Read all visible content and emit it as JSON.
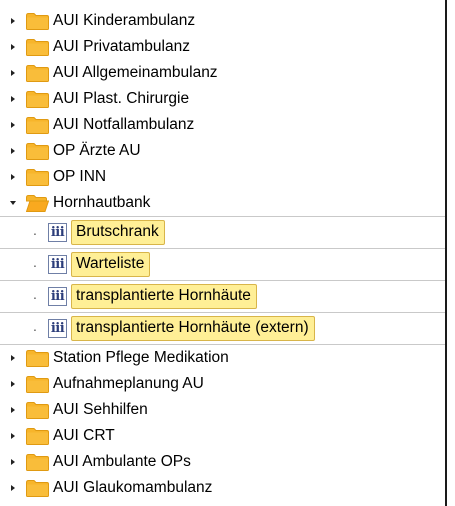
{
  "tree": {
    "top_items": [
      {
        "label": "AUI Kinderambulanz"
      },
      {
        "label": "AUI Privatambulanz"
      },
      {
        "label": "AUI Allgemeinambulanz"
      },
      {
        "label": "AUI Plast. Chirurgie"
      },
      {
        "label": "AUI Notfallambulanz"
      },
      {
        "label": "OP Ärzte AU"
      },
      {
        "label": "OP INN"
      }
    ],
    "expanded": {
      "label": "Hornhautbank",
      "children": [
        {
          "label": "Brutschrank"
        },
        {
          "label": "Warteliste"
        },
        {
          "label": "transplantierte Hornhäute"
        },
        {
          "label": "transplantierte Hornhäute (extern)"
        }
      ]
    },
    "bottom_items": [
      {
        "label": "Station Pflege Medikation"
      },
      {
        "label": "Aufnahmeplanung AU"
      },
      {
        "label": "AUI Sehhilfen"
      },
      {
        "label": "AUI CRT"
      },
      {
        "label": "AUI Ambulante OPs"
      },
      {
        "label": "AUI Glaukomambulanz"
      }
    ],
    "table_icon_glyph": "iii",
    "child_bullet": "·"
  },
  "colors": {
    "folder": "#f7b52b",
    "folder_dark": "#e09a12",
    "highlight": "#ffef96",
    "highlight_border": "#d8b54a",
    "table_icon": "#2c3d7a"
  },
  "icons": [
    "expand-arrow-icon",
    "collapse-arrow-icon",
    "folder-icon",
    "open-folder-icon",
    "table-icon"
  ]
}
